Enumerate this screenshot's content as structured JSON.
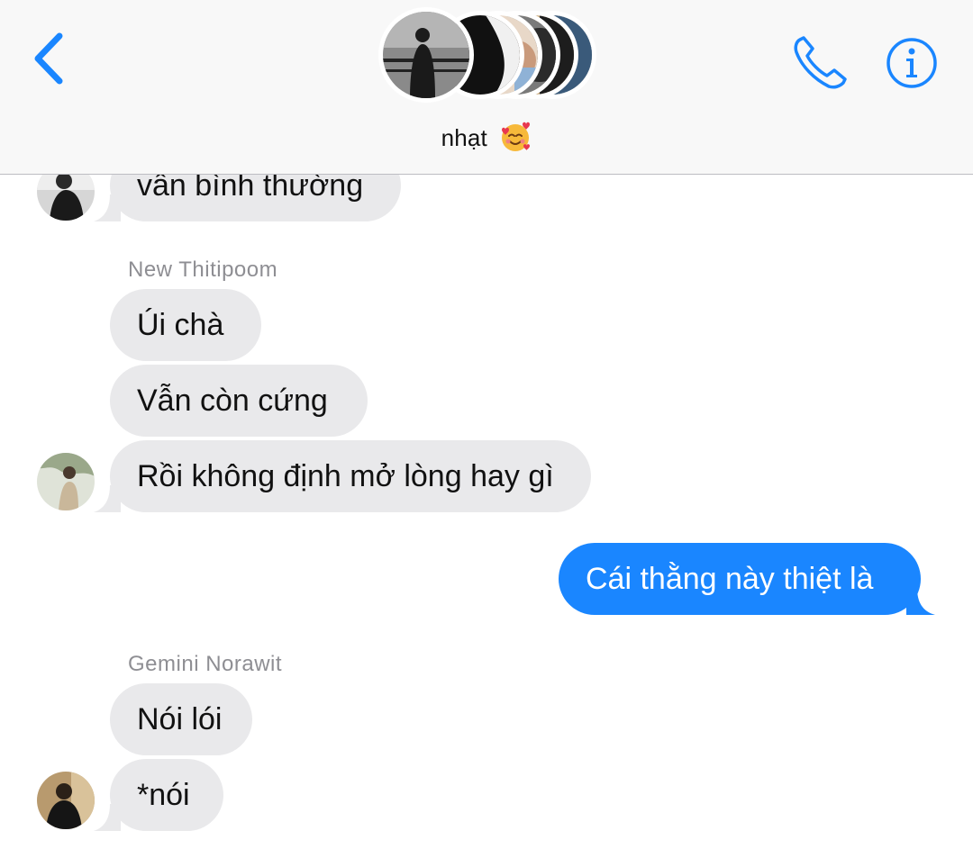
{
  "header": {
    "group_name": "nhạt",
    "group_emoji": "smiling-face-with-hearts",
    "back_icon": "chevron-left-icon",
    "call_icon": "phone-icon",
    "info_icon": "info-icon",
    "accent_color": "#1a86ff"
  },
  "messages": [
    {
      "type": "incoming",
      "text": "vẫn bình thường"
    },
    {
      "type": "sender",
      "text": "New Thitipoom"
    },
    {
      "type": "incoming",
      "text": "Úi chà"
    },
    {
      "type": "incoming",
      "text": "Vẫn còn cứng"
    },
    {
      "type": "incoming",
      "text": "Rồi không định mở lòng hay gì"
    },
    {
      "type": "outgoing",
      "text": "Cái thằng này thiệt là"
    },
    {
      "type": "sender",
      "text": "Gemini Norawit"
    },
    {
      "type": "incoming",
      "text": "Nói lói"
    },
    {
      "type": "incoming",
      "text": "*nói"
    }
  ],
  "colors": {
    "incoming_bubble": "#e9e9eb",
    "outgoing_bubble": "#1a86ff",
    "sender_name": "#8e8e93"
  }
}
